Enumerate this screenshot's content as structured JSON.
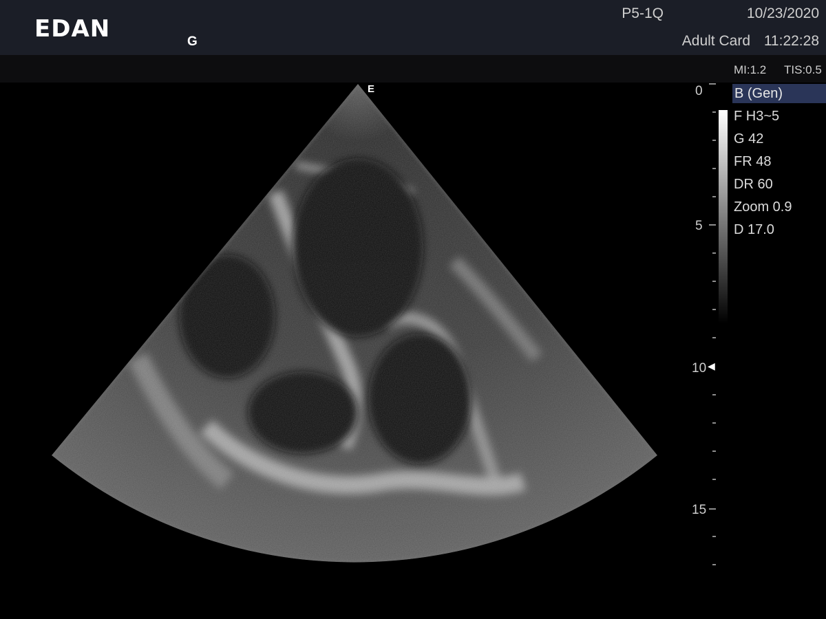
{
  "header": {
    "logo": "EDAN",
    "gain_marker": "G",
    "probe": "P5-1Q",
    "preset": "Adult Card",
    "date": "10/23/2020",
    "time": "11:22:28"
  },
  "indices": {
    "mi": "MI:1.2",
    "tis": "TIS:0.5"
  },
  "mode": "B (Gen)",
  "params": [
    "F H3~5",
    "G 42",
    "FR 48",
    "DR 60",
    "Zoom 0.9",
    "D 17.0"
  ],
  "depth_scale": {
    "labels": [
      "0",
      "5",
      "10",
      "15"
    ],
    "focus_marker": "◀"
  },
  "orientation_marker": "E"
}
